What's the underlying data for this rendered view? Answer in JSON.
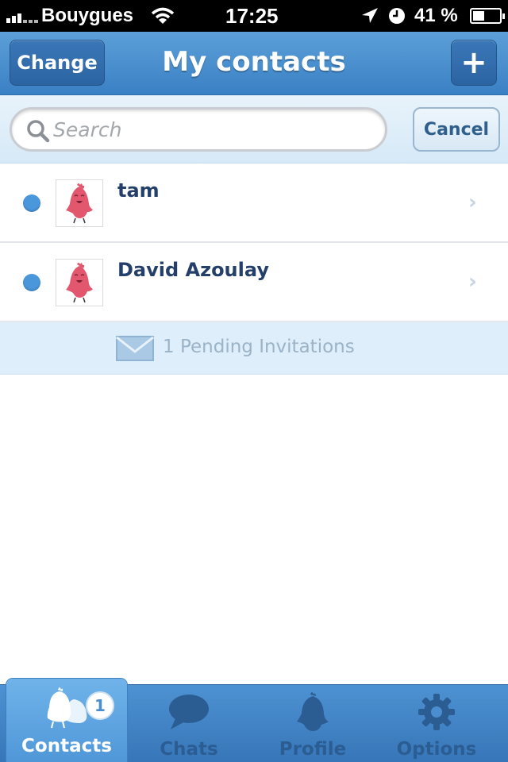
{
  "status_bar": {
    "carrier": "Bouygues",
    "time": "17:25",
    "battery_percent": "41 %"
  },
  "nav": {
    "left_button": "Change",
    "title": "My contacts",
    "right_button": "+"
  },
  "search": {
    "placeholder": "Search",
    "cancel_label": "Cancel"
  },
  "contacts": [
    {
      "name": "tam",
      "status_color": "#4a97dc"
    },
    {
      "name": "David Azoulay",
      "status_color": "#4a97dc"
    }
  ],
  "pending": {
    "label": "1 Pending Invitations"
  },
  "tabs": [
    {
      "label": "Contacts",
      "icon": "chicks-icon",
      "badge": "1",
      "active": true
    },
    {
      "label": "Chats",
      "icon": "speech-bubble-icon",
      "active": false
    },
    {
      "label": "Profile",
      "icon": "chick-silhouette-icon",
      "active": false
    },
    {
      "label": "Options",
      "icon": "gear-icon",
      "active": false
    }
  ],
  "colors": {
    "nav_blue": "#3a80c4",
    "accent": "#4a97dc",
    "name_text": "#233f6a",
    "avatar_pink": "#e2566e"
  }
}
